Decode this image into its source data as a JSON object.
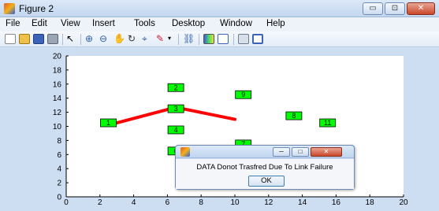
{
  "window": {
    "title": "Figure 2",
    "controls": {
      "minimize": "▭",
      "maximize": "⊡",
      "close": "✕"
    }
  },
  "menu": [
    "File",
    "Edit",
    "View",
    "Insert",
    "Tools",
    "Desktop",
    "Window",
    "Help"
  ],
  "toolbar_icons": [
    "new-figure-icon",
    "open-file-icon",
    "save-icon",
    "print-icon",
    "pointer-arrow-icon",
    "zoom-in-icon",
    "zoom-out-icon",
    "pan-hand-icon",
    "rotate-3d-icon",
    "data-cursor-icon",
    "brush-icon",
    "brush-dropdown-icon",
    "link-plot-icon",
    "insert-colorbar-icon",
    "insert-legend-icon",
    "hide-plot-tools-icon",
    "show-plot-tools-icon"
  ],
  "chart_data": {
    "type": "scatter",
    "xlim": [
      0,
      20
    ],
    "ylim": [
      0,
      20
    ],
    "xticks": [
      0,
      2,
      4,
      6,
      8,
      10,
      12,
      14,
      16,
      18,
      20
    ],
    "yticks": [
      0,
      2,
      4,
      6,
      8,
      10,
      12,
      14,
      16,
      18,
      20
    ],
    "grid": false,
    "node_color": "#00ff00",
    "line_color": "#ff0000",
    "nodes": [
      {
        "label": "1",
        "x": 2.5,
        "y": 10.5
      },
      {
        "label": "2",
        "x": 6.5,
        "y": 15.5
      },
      {
        "label": "3",
        "x": 6.5,
        "y": 12.5
      },
      {
        "label": "4",
        "x": 6.5,
        "y": 9.5
      },
      {
        "label": "6",
        "x": 6.5,
        "y": 6.5
      },
      {
        "label": "7",
        "x": 10.5,
        "y": 7.5
      },
      {
        "label": "8",
        "x": 13.5,
        "y": 11.5
      },
      {
        "label": "9",
        "x": 10.5,
        "y": 14.5
      },
      {
        "label": "11",
        "x": 15.5,
        "y": 10.5
      }
    ],
    "route": [
      {
        "x": 3.0,
        "y": 10.5
      },
      {
        "x": 6.5,
        "y": 12.7
      },
      {
        "x": 10.0,
        "y": 11.0
      }
    ]
  },
  "dialog": {
    "message": "DATA Donot Trasfred Due To Link Failure",
    "ok_label": "OK",
    "controls": {
      "minimize": "─",
      "maximize": "□",
      "close": "✕"
    }
  }
}
